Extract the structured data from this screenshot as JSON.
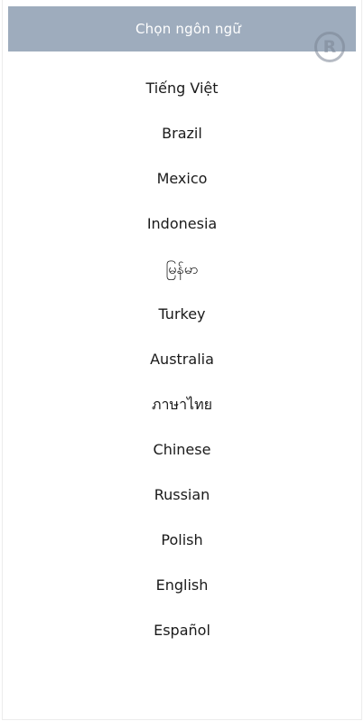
{
  "header": {
    "title": "Chọn ngôn ngữ",
    "badge_icon": "registered-icon"
  },
  "languages": [
    "Tiếng Việt",
    "Brazil",
    "Mexico",
    "Indonesia",
    "မြန်မာ",
    "Turkey",
    "Australia",
    "ภาษาไทย",
    "Chinese",
    "Russian",
    "Polish",
    "English",
    "Español"
  ],
  "colors": {
    "header_bg": "#9eacbd",
    "header_text": "#ffffff",
    "item_text": "#1a1a1a"
  }
}
